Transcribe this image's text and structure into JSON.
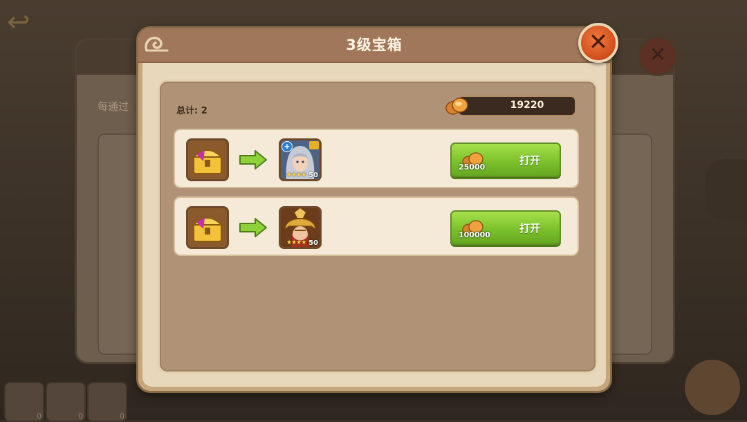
{
  "dialog": {
    "title": "3级宝箱",
    "total_label": "总计: 2",
    "gold_amount": "19220"
  },
  "background": {
    "panel_text": "每通过",
    "slot_counts": [
      "0",
      "0",
      "0"
    ]
  },
  "rows": [
    {
      "cost": "25000",
      "button_label": "打开",
      "hero_level": "50",
      "hero_stars": "★★★★",
      "hero_icon": "silver-haired-hero-portrait"
    },
    {
      "cost": "100000",
      "button_label": "打开",
      "hero_level": "50",
      "hero_stars": "★★★★",
      "hero_icon": "golden-helmet-hero-portrait"
    }
  ],
  "colors": {
    "button_green": "#7cc22c",
    "close_orange": "#d14d1a",
    "panel_tan": "#c6a77d"
  }
}
